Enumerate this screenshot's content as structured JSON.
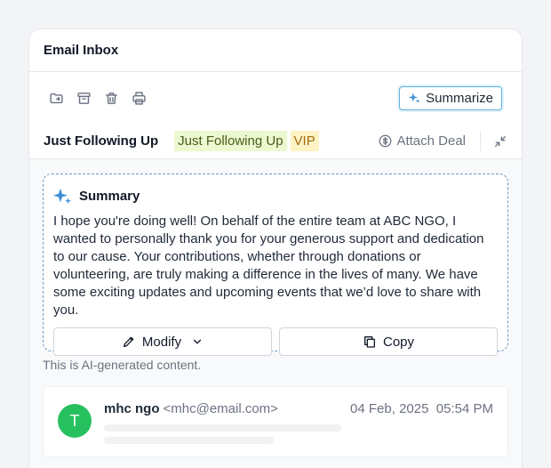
{
  "header": {
    "title": "Email Inbox"
  },
  "toolbar": {
    "icons": [
      "move-to-folder-icon",
      "archive-icon",
      "trash-icon",
      "print-icon"
    ],
    "summarize_label": "Summarize"
  },
  "subject_row": {
    "subject": "Just Following Up",
    "tags": [
      {
        "label": "Just Following Up",
        "bg": "#ecf8cf",
        "color": "#4b5d1c"
      },
      {
        "label": "VIP",
        "bg": "#fdf3c4",
        "color": "#a06b12"
      }
    ],
    "attach_deal_label": "Attach Deal"
  },
  "summary": {
    "title": "Summary",
    "text": "I hope you're doing well! On behalf of the entire team at ABC NGO, I wanted to personally thank you for your generous support and dedication to our cause. Your contributions, whether through donations or volunteering, are truly making a difference in the lives of many. We have some exciting updates and upcoming events that we’d love to share with you.",
    "modify_label": "Modify",
    "copy_label": "Copy"
  },
  "ai_note": "This is AI-generated content.",
  "email": {
    "avatar_letter": "T",
    "avatar_color": "#26c15e",
    "sender_name": "mhc ngo",
    "sender_email": "<mhc@email.com>",
    "date": "04 Feb, 2025  05:54 PM"
  },
  "colors": {
    "accent_border": "#5fb2d8",
    "summary_border": "#6a98c7",
    "sparkle": "#3b8fd6"
  }
}
